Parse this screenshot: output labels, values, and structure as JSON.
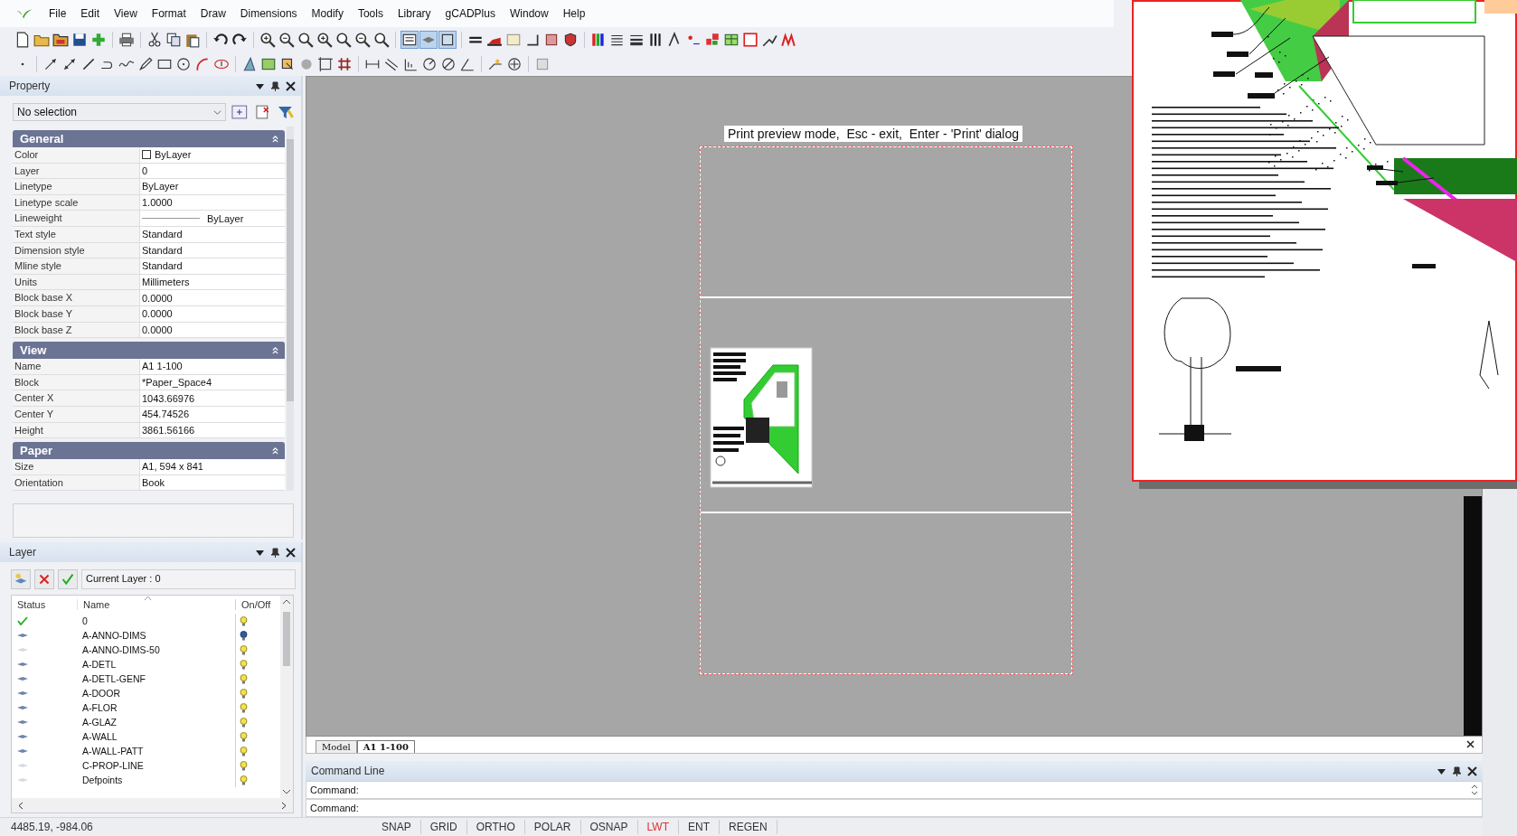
{
  "menu": [
    "File",
    "Edit",
    "View",
    "Format",
    "Draw",
    "Dimensions",
    "Modify",
    "Tools",
    "Library",
    "gCADPlus",
    "Window",
    "Help"
  ],
  "property_panel": {
    "title": "Property",
    "selection": "No selection",
    "sections": [
      {
        "title": "General",
        "expanded": true,
        "rows": [
          {
            "label": "Color",
            "value": "ByLayer",
            "kind": "color"
          },
          {
            "label": "Layer",
            "value": "0",
            "kind": "text"
          },
          {
            "label": "Linetype",
            "value": "ByLayer",
            "kind": "text"
          },
          {
            "label": "Linetype scale",
            "value": "1.0000",
            "kind": "text"
          },
          {
            "label": "Lineweight",
            "value": "ByLayer",
            "kind": "lineweight"
          },
          {
            "label": "Text style",
            "value": "Standard",
            "kind": "text"
          },
          {
            "label": "Dimension style",
            "value": "Standard",
            "kind": "text"
          },
          {
            "label": "Mline style",
            "value": "Standard",
            "kind": "text"
          },
          {
            "label": "Units",
            "value": "Millimeters",
            "kind": "text"
          },
          {
            "label": "Block base X",
            "value": "0.0000",
            "kind": "text"
          },
          {
            "label": "Block base Y",
            "value": "0.0000",
            "kind": "text"
          },
          {
            "label": "Block base Z",
            "value": "0.0000",
            "kind": "text"
          }
        ]
      },
      {
        "title": "View",
        "expanded": true,
        "rows": [
          {
            "label": "Name",
            "value": "A1 1-100",
            "kind": "text"
          },
          {
            "label": "Block",
            "value": "*Paper_Space4",
            "kind": "text"
          },
          {
            "label": "Center X",
            "value": "1043.66976",
            "kind": "text"
          },
          {
            "label": "Center Y",
            "value": "454.74526",
            "kind": "text"
          },
          {
            "label": "Height",
            "value": "3861.56166",
            "kind": "text"
          }
        ]
      },
      {
        "title": "Paper",
        "expanded": true,
        "rows": [
          {
            "label": "Size",
            "value": "A1,  594 x 841",
            "kind": "text"
          },
          {
            "label": "Orientation",
            "value": "Book",
            "kind": "text"
          }
        ]
      }
    ]
  },
  "layer_panel": {
    "title": "Layer",
    "current_layer": "Current Layer : 0",
    "columns": [
      "Status",
      "Name",
      "On/Off"
    ],
    "layers": [
      {
        "name": "0",
        "current": true,
        "used": true,
        "on": true
      },
      {
        "name": "A-ANNO-DIMS",
        "current": false,
        "used": true,
        "on": false
      },
      {
        "name": "A-ANNO-DIMS-50",
        "current": false,
        "used": false,
        "on": true
      },
      {
        "name": "A-DETL",
        "current": false,
        "used": true,
        "on": true
      },
      {
        "name": "A-DETL-GENF",
        "current": false,
        "used": true,
        "on": true
      },
      {
        "name": "A-DOOR",
        "current": false,
        "used": true,
        "on": true
      },
      {
        "name": "A-FLOR",
        "current": false,
        "used": true,
        "on": true
      },
      {
        "name": "A-GLAZ",
        "current": false,
        "used": true,
        "on": true
      },
      {
        "name": "A-WALL",
        "current": false,
        "used": true,
        "on": true
      },
      {
        "name": "A-WALL-PATT",
        "current": false,
        "used": true,
        "on": true
      },
      {
        "name": "C-PROP-LINE",
        "current": false,
        "used": false,
        "on": true
      },
      {
        "name": "Defpoints",
        "current": false,
        "used": false,
        "on": true
      }
    ]
  },
  "canvas": {
    "message": "Print preview mode,  Esc - exit,  Enter - 'Print' dialog"
  },
  "tabs": [
    {
      "label": "Model",
      "selected": false
    },
    {
      "label": "A1 1-100",
      "selected": true
    }
  ],
  "command_line": {
    "title": "Command Line",
    "prompt": "Command:",
    "history": [
      "Command:"
    ]
  },
  "status_bar": {
    "coordinates": "4485.19, -984.06",
    "toggles": [
      {
        "label": "SNAP",
        "on": false
      },
      {
        "label": "GRID",
        "on": false
      },
      {
        "label": "ORTHO",
        "on": false
      },
      {
        "label": "POLAR",
        "on": false
      },
      {
        "label": "OSNAP",
        "on": false
      },
      {
        "label": "LWT",
        "on": true
      },
      {
        "label": "ENT",
        "on": false
      },
      {
        "label": "REGEN",
        "on": false
      }
    ]
  }
}
